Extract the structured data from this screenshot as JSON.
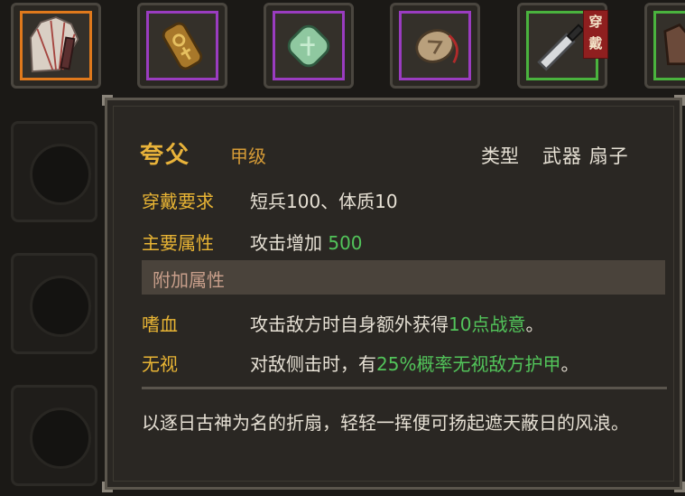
{
  "inventory": {
    "slots": [
      {
        "item": "folding-fan",
        "rarity_color": "#e0791c",
        "selected": true
      },
      {
        "item": "gold-ornament",
        "rarity_color": "#9a3cc0"
      },
      {
        "item": "jade-stone",
        "rarity_color": "#9a3cc0"
      },
      {
        "item": "pouch",
        "rarity_color": "#9a3cc0"
      },
      {
        "item": "blade",
        "rarity_color": "#4ab33e",
        "badge": [
          "穿",
          "戴"
        ]
      },
      {
        "item": "armor",
        "rarity_color": "#4ab33e"
      }
    ]
  },
  "tooltip": {
    "name": "夸父",
    "grade": "甲级",
    "type_label": "类型",
    "type_value": "武器 扇子",
    "requirement_label": "穿戴要求",
    "requirement_value": "短兵100、体质10",
    "main_attr_label": "主要属性",
    "main_attr_text": "攻击增加",
    "main_attr_value": "500",
    "extra_header": "附加属性",
    "extras": [
      {
        "label": "嗜血",
        "text_pre": "攻击敌方时自身额外获得",
        "highlight": "10点战意",
        "text_post": "。"
      },
      {
        "label": "无视",
        "text_pre": "对敌侧击时，有",
        "highlight": "25%概率无视敌方护甲",
        "text_post": "。"
      }
    ],
    "description": "以逐日古神为名的折扇，轻轻一挥便可扬起遮天蔽日的风浪。"
  }
}
